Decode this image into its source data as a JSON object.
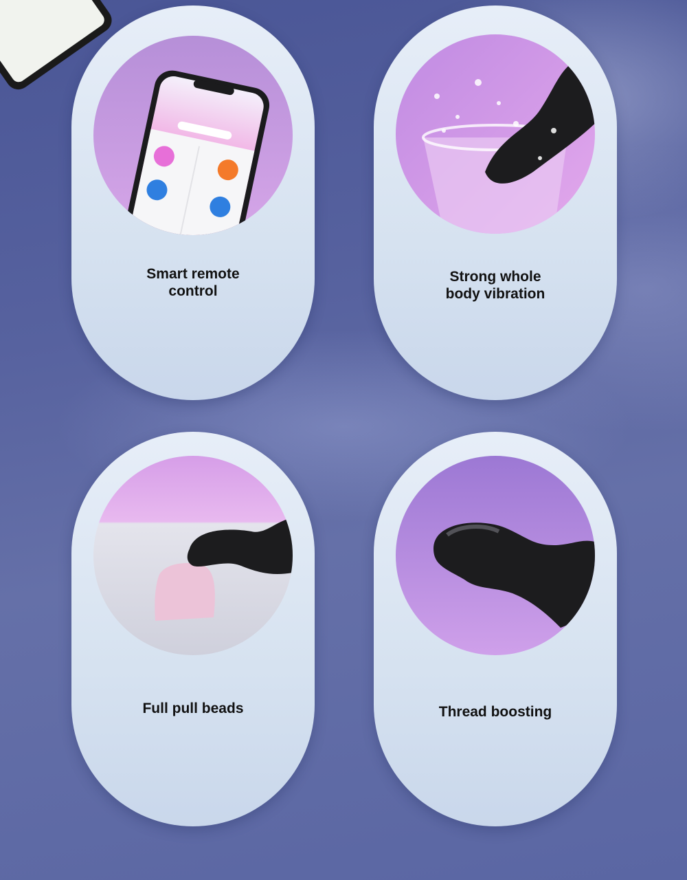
{
  "features": [
    {
      "title_lines": [
        "Smart remote",
        "control"
      ]
    },
    {
      "title_lines": [
        "Strong whole",
        "body vibration"
      ]
    },
    {
      "title_lines": [
        "Full pull beads"
      ]
    },
    {
      "title_lines": [
        "Thread boosting"
      ]
    }
  ],
  "colors": {
    "background": "#5a65a2",
    "card": "#dde7f3",
    "circle_pink": "#d59ae6",
    "circle_purple": "#b07fd6",
    "product_black": "#1c1c1e"
  },
  "icons": [
    "app-phone-photo",
    "water-splash-photo",
    "pink-ice-photo",
    "product-closeup-photo"
  ]
}
